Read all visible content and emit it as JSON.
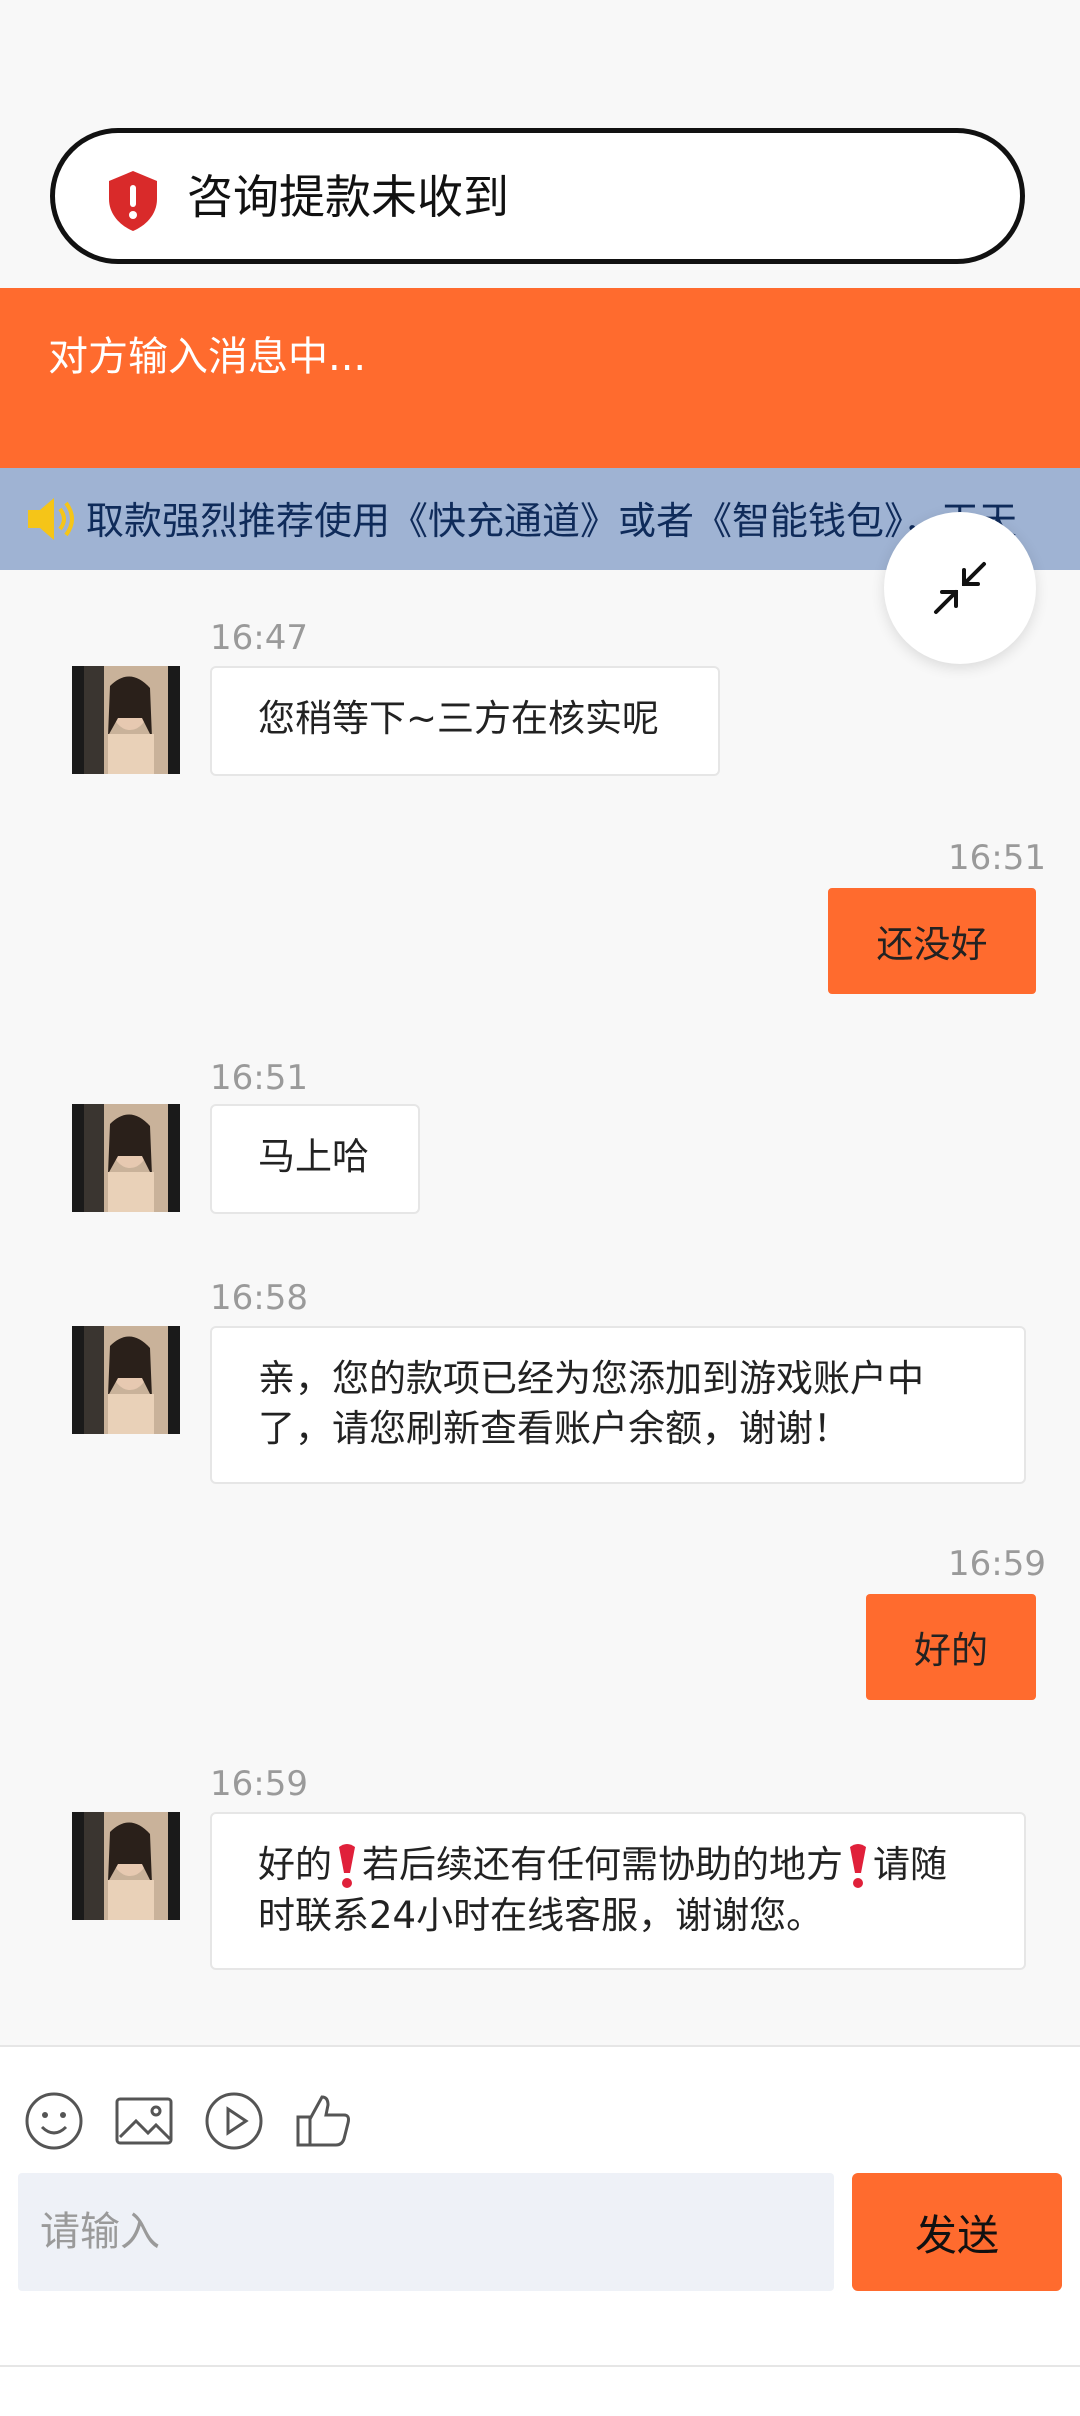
{
  "header": {
    "title": "咨询提款未收到"
  },
  "status": {
    "typing_text": "对方输入消息中..."
  },
  "notice": {
    "marquee_text": "取款强烈推荐使用《快充通道》或者《智能钱包》，天天"
  },
  "messages": [
    {
      "side": "in",
      "time": "16:47",
      "text": "您稍等下~三方在核实呢"
    },
    {
      "side": "out",
      "time": "16:51",
      "text": "还没好"
    },
    {
      "side": "in",
      "time": "16:51",
      "text": "马上哈"
    },
    {
      "side": "in",
      "time": "16:58",
      "text": "亲，您的款项已经为您添加到游戏账户中了，请您刷新查看账户余额，谢谢！"
    },
    {
      "side": "out",
      "time": "16:59",
      "text": "好的"
    },
    {
      "side": "in",
      "time": "16:59",
      "text_part1": "好的",
      "text_part2": "若后续还有任何需协助的地方",
      "text_part3": "请随时联系24小时在线客服，谢谢您。"
    }
  ],
  "composer": {
    "placeholder": "请输入",
    "send_label": "发送"
  },
  "colors": {
    "accent": "#ff6b2e",
    "notice_bg": "#9fb3d3",
    "notice_text": "#0f2b5a"
  },
  "icons": [
    "shield-alert-icon",
    "speaker-icon",
    "collapse-icon",
    "emoji-icon",
    "image-icon",
    "play-icon",
    "thumbs-up-icon"
  ]
}
